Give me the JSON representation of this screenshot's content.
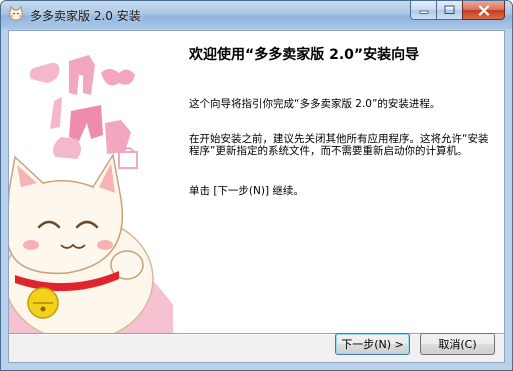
{
  "window": {
    "title": "多多卖家版 2.0 安装"
  },
  "welcome": {
    "heading": "欢迎使用“多多卖家版 2.0”安装向导",
    "paragraph1": "这个向导将指引你完成“多多卖家版 2.0”的安装进程。",
    "paragraph2": "在开始安装之前，建议先关闭其他所有应用程序。这将允许“安装程序”更新指定的系统文件，而不需要重新启动你的计算机。",
    "paragraph3": "单击 [下一步(N)] 继续。"
  },
  "buttons": {
    "next_label": "下一步(N) >",
    "cancel_label": "取消(C)"
  },
  "colors": {
    "banner_pink": "#f3a7bf",
    "cat_collar": "#e0242e",
    "bell": "#f2d21a"
  }
}
